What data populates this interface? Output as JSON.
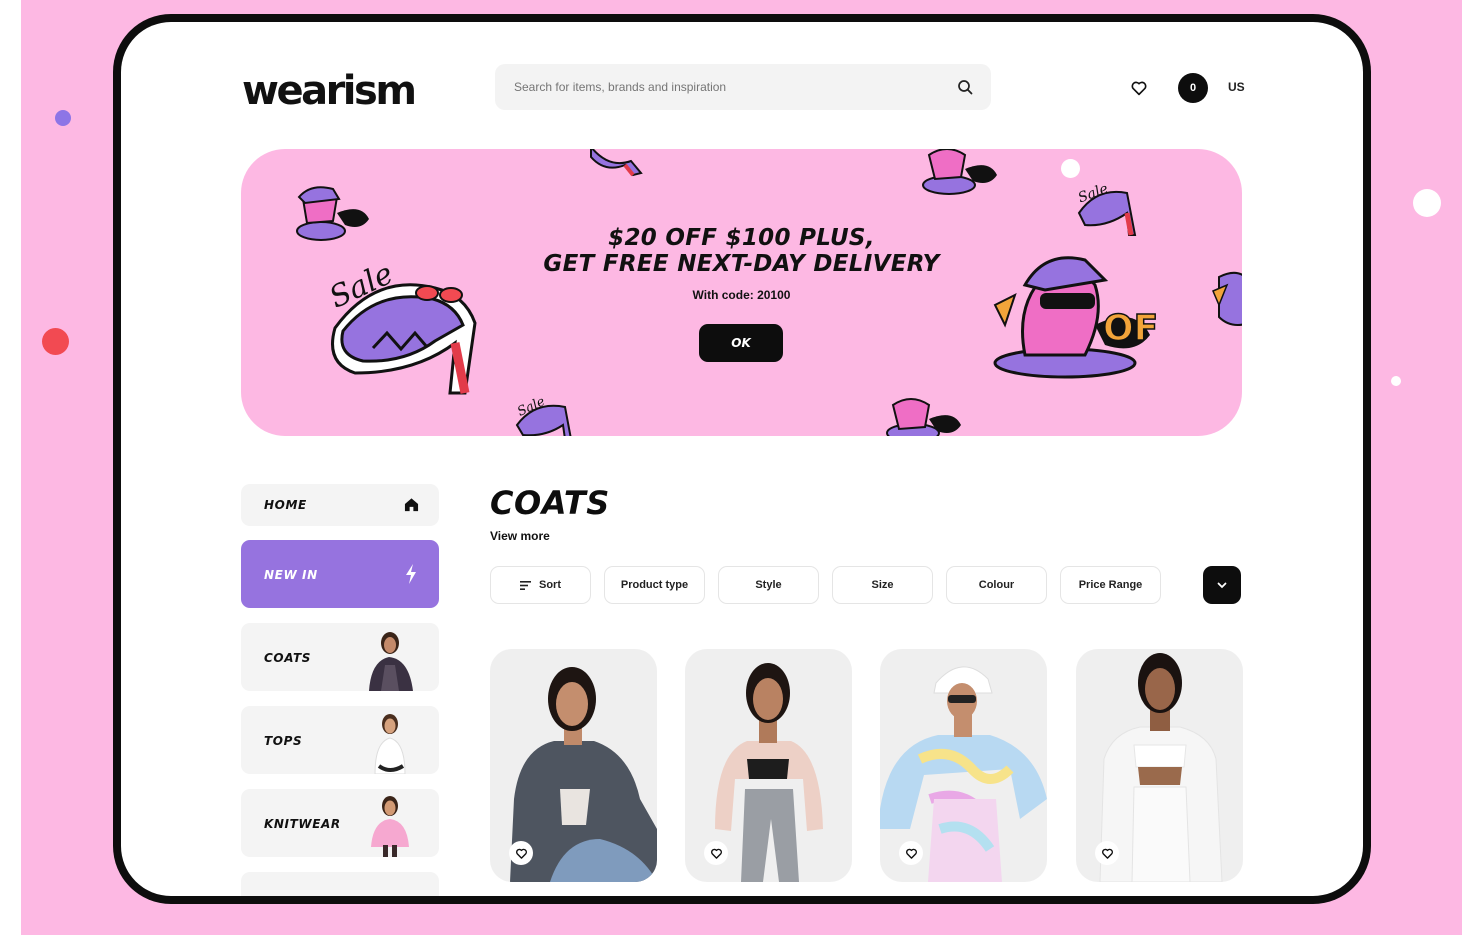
{
  "brand": {
    "logo_text": "wearism"
  },
  "search": {
    "placeholder": "Search for items, brands and inspiration",
    "icon": "search-icon"
  },
  "header": {
    "wishlist_icon": "heart-icon",
    "cart_count": "0",
    "locale": "US"
  },
  "banner": {
    "line1": "$20 OFF $100 PLUS,",
    "line2": "GET FREE NEXT-DAY DELIVERY",
    "code_text": "With code: 20100",
    "button_label": "OK"
  },
  "sidebar": {
    "items": [
      {
        "label": "HOME",
        "icon": "home-icon"
      },
      {
        "label": "NEW IN",
        "icon": "lightning-icon"
      },
      {
        "label": "COATS"
      },
      {
        "label": "TOPS"
      },
      {
        "label": "KNITWEAR"
      }
    ]
  },
  "main": {
    "title": "COATS",
    "view_more": "View more",
    "filters": [
      "Sort",
      "Product type",
      "Style",
      "Size",
      "Colour",
      "Price Range"
    ],
    "more_filters_icon": "chevron-down-icon",
    "products": [
      {
        "fav_icon": "heart-icon"
      },
      {
        "fav_icon": "heart-icon"
      },
      {
        "fav_icon": "heart-icon"
      },
      {
        "fav_icon": "heart-icon"
      }
    ]
  },
  "colors": {
    "background_pink": "#fdb8e3",
    "accent_purple": "#9673df",
    "dark": "#0d0d0d",
    "dot_red": "#f24a52"
  }
}
